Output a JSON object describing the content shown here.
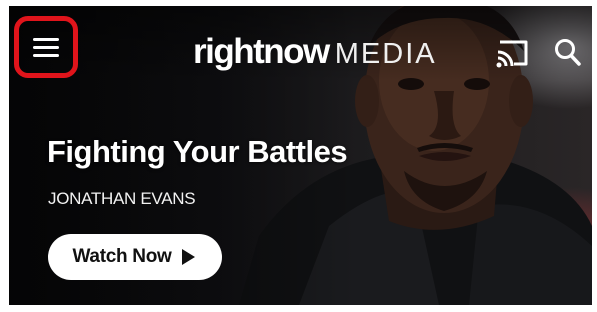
{
  "header": {
    "menu_icon": "hamburger-menu-icon",
    "menu_highlight_color": "#e0141b",
    "brand_main": "rightnow",
    "brand_sub": "MEDIA",
    "cast_icon": "cast-icon",
    "search_icon": "search-icon"
  },
  "hero": {
    "title": "Fighting Your Battles",
    "speaker": "JONATHAN EVANS",
    "watch_button_label": "Watch Now",
    "watch_button_icon": "play-icon"
  }
}
